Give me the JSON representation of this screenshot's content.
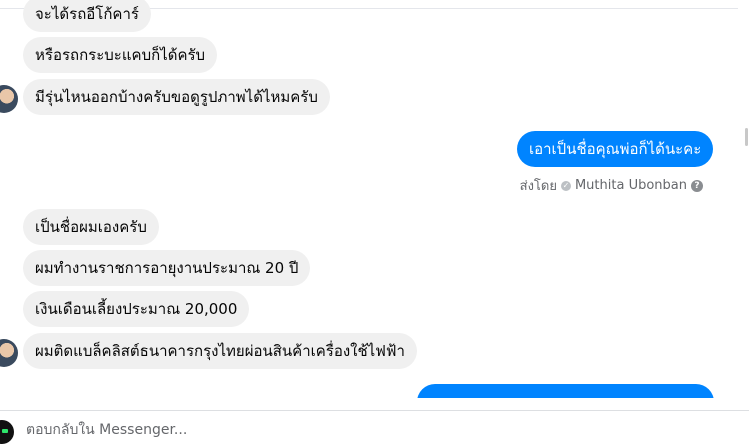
{
  "messages": {
    "m1": "จะได้รถอีโก้คาร์",
    "m2": "หรือรถกระบะแคบก็ได้ครับ",
    "m3": "มีรุ่นไหนออกบ้างครับขอดูรูปภาพได้ไหมครับ",
    "m4": "เอาเป็นชื่อคุณพ่อก็ได้นะคะ",
    "m5": "เป็นชื่อผมเองครับ",
    "m6": "ผมทำงานราชการอายุงานประมาณ 20 ปี",
    "m7": "เงินเดือนเลี้ยงประมาณ 20,000",
    "m8": "ผมติดแบล็คลิสต์ธนาคารกรุงไทยผ่อนสินค้าเครื่องใช้ไฟฟ้า"
  },
  "sent_by": {
    "prefix": "ส่งโดย",
    "name": "Muthita Ubonban"
  },
  "composer": {
    "placeholder": "ตอบกลับใน Messenger..."
  },
  "colors": {
    "outgoing": "#0084ff",
    "incoming": "#f0f0f0"
  },
  "icons": {
    "check": "check-circle-icon",
    "help": "help-circle-icon"
  }
}
